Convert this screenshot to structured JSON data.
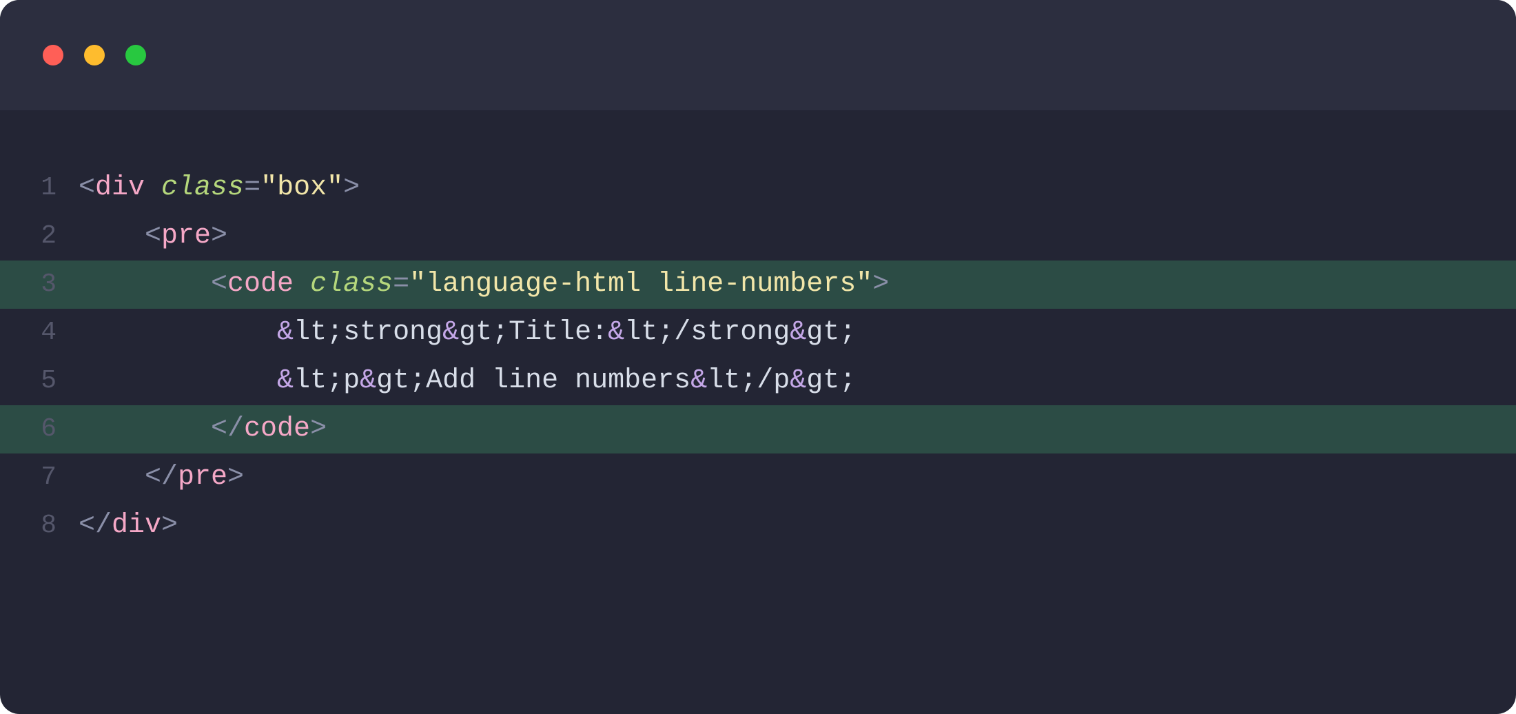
{
  "window": {
    "traffic_lights": [
      "#ff5f57",
      "#febc2e",
      "#28c840"
    ]
  },
  "code": {
    "lines": [
      {
        "num": "1",
        "highlighted": false,
        "indent": 0,
        "tokens": [
          {
            "t": "punct",
            "v": "<"
          },
          {
            "t": "tag",
            "v": "div"
          },
          {
            "t": "space",
            "v": " "
          },
          {
            "t": "attr",
            "v": "class"
          },
          {
            "t": "op",
            "v": "="
          },
          {
            "t": "string",
            "v": "\"box\""
          },
          {
            "t": "punct",
            "v": ">"
          }
        ]
      },
      {
        "num": "2",
        "highlighted": false,
        "indent": 1,
        "tokens": [
          {
            "t": "punct",
            "v": "<"
          },
          {
            "t": "tag",
            "v": "pre"
          },
          {
            "t": "punct",
            "v": ">"
          }
        ]
      },
      {
        "num": "3",
        "highlighted": true,
        "indent": 2,
        "tokens": [
          {
            "t": "punct",
            "v": "<"
          },
          {
            "t": "tag",
            "v": "code"
          },
          {
            "t": "space",
            "v": " "
          },
          {
            "t": "attr",
            "v": "class"
          },
          {
            "t": "op",
            "v": "="
          },
          {
            "t": "string",
            "v": "\"language-html line-numbers\""
          },
          {
            "t": "punct",
            "v": ">"
          }
        ]
      },
      {
        "num": "4",
        "highlighted": false,
        "indent": 3,
        "tokens": [
          {
            "t": "entity",
            "amp": "&",
            "name": "lt;"
          },
          {
            "t": "text",
            "v": "strong"
          },
          {
            "t": "entity",
            "amp": "&",
            "name": "gt;"
          },
          {
            "t": "text",
            "v": "Title:"
          },
          {
            "t": "entity",
            "amp": "&",
            "name": "lt;"
          },
          {
            "t": "text",
            "v": "/strong"
          },
          {
            "t": "entity",
            "amp": "&",
            "name": "gt;"
          }
        ]
      },
      {
        "num": "5",
        "highlighted": false,
        "indent": 3,
        "tokens": [
          {
            "t": "entity",
            "amp": "&",
            "name": "lt;"
          },
          {
            "t": "text",
            "v": "p"
          },
          {
            "t": "entity",
            "amp": "&",
            "name": "gt;"
          },
          {
            "t": "text",
            "v": "Add line numbers"
          },
          {
            "t": "entity",
            "amp": "&",
            "name": "lt;"
          },
          {
            "t": "text",
            "v": "/p"
          },
          {
            "t": "entity",
            "amp": "&",
            "name": "gt;"
          }
        ]
      },
      {
        "num": "6",
        "highlighted": true,
        "indent": 2,
        "tokens": [
          {
            "t": "punct",
            "v": "</"
          },
          {
            "t": "tag",
            "v": "code"
          },
          {
            "t": "punct",
            "v": ">"
          }
        ]
      },
      {
        "num": "7",
        "highlighted": false,
        "indent": 1,
        "tokens": [
          {
            "t": "punct",
            "v": "</"
          },
          {
            "t": "tag",
            "v": "pre"
          },
          {
            "t": "punct",
            "v": ">"
          }
        ]
      },
      {
        "num": "8",
        "highlighted": false,
        "indent": 0,
        "tokens": [
          {
            "t": "punct",
            "v": "</"
          },
          {
            "t": "tag",
            "v": "div"
          },
          {
            "t": "punct",
            "v": ">"
          }
        ]
      }
    ]
  }
}
